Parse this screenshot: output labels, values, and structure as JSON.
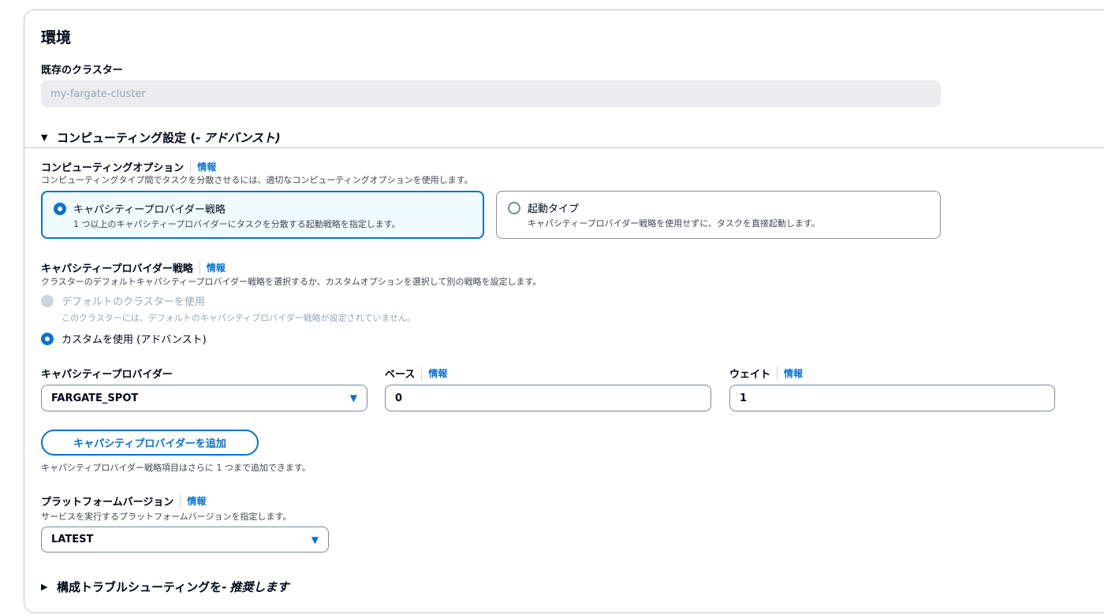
{
  "environment": {
    "title": "環境",
    "existing_cluster_label": "既存のクラスター",
    "existing_cluster_value": "my-fargate-cluster"
  },
  "compute_section": {
    "toggle_label": "コンピューティング設定 (-",
    "toggle_suffix": "アドバンスト)",
    "compute_option": {
      "label": "コンピューティングオプション",
      "info": "情報",
      "description": "コンピューティングタイプ間でタスクを分散させるには、適切なコンピューティングオプションを使用します。",
      "tiles": [
        {
          "title": "キャパシティープロバイダー戦略",
          "description": "1 つ以上のキャパシティープロバイダーにタスクを分散する起動戦略を指定します。",
          "selected": true
        },
        {
          "title": "起動タイプ",
          "description": "キャパシティープロバイダー戦略を使用せずに、タスクを直接起動します。",
          "selected": false
        }
      ]
    },
    "strategy": {
      "label": "キャパシティープロバイダー戦略",
      "info": "情報",
      "description": "クラスターのデフォルトキャパシティープロバイダー戦略を選択するか、カスタムオプションを選択して別の戦略を設定します。",
      "options": [
        {
          "label": "デフォルトのクラスターを使用",
          "description": "このクラスターには、デフォルトのキャパシティプロバイダー戦略が設定されていません。",
          "state": "disabled"
        },
        {
          "label": "カスタムを使用 (アドバンスト)",
          "state": "selected"
        }
      ]
    },
    "provider_row": {
      "provider_label": "キャパシティープロバイダー",
      "provider_value": "FARGATE_SPOT",
      "base_label": "ベース",
      "base_info": "情報",
      "base_value": "0",
      "weight_label": "ウェイト",
      "weight_info": "情報",
      "weight_value": "1"
    },
    "add_provider": {
      "button_label": "キャパシティプロバイダーを追加",
      "hint": "キャパシティプロバイダー戦略項目はさらに 1 つまで追加できます。"
    },
    "platform": {
      "label": "プラットフォームバージョン",
      "info": "情報",
      "description": "サービスを実行するプラットフォームバージョンを指定します。",
      "value": "LATEST"
    }
  },
  "troubleshooting": {
    "toggle_label": "構成トラブルシューティングを-",
    "toggle_suffix": "推奨します"
  },
  "colors": {
    "accent": "#0972d3",
    "selected_tile_bg": "#f0fbff",
    "disabled_bg": "#ebebf0"
  }
}
